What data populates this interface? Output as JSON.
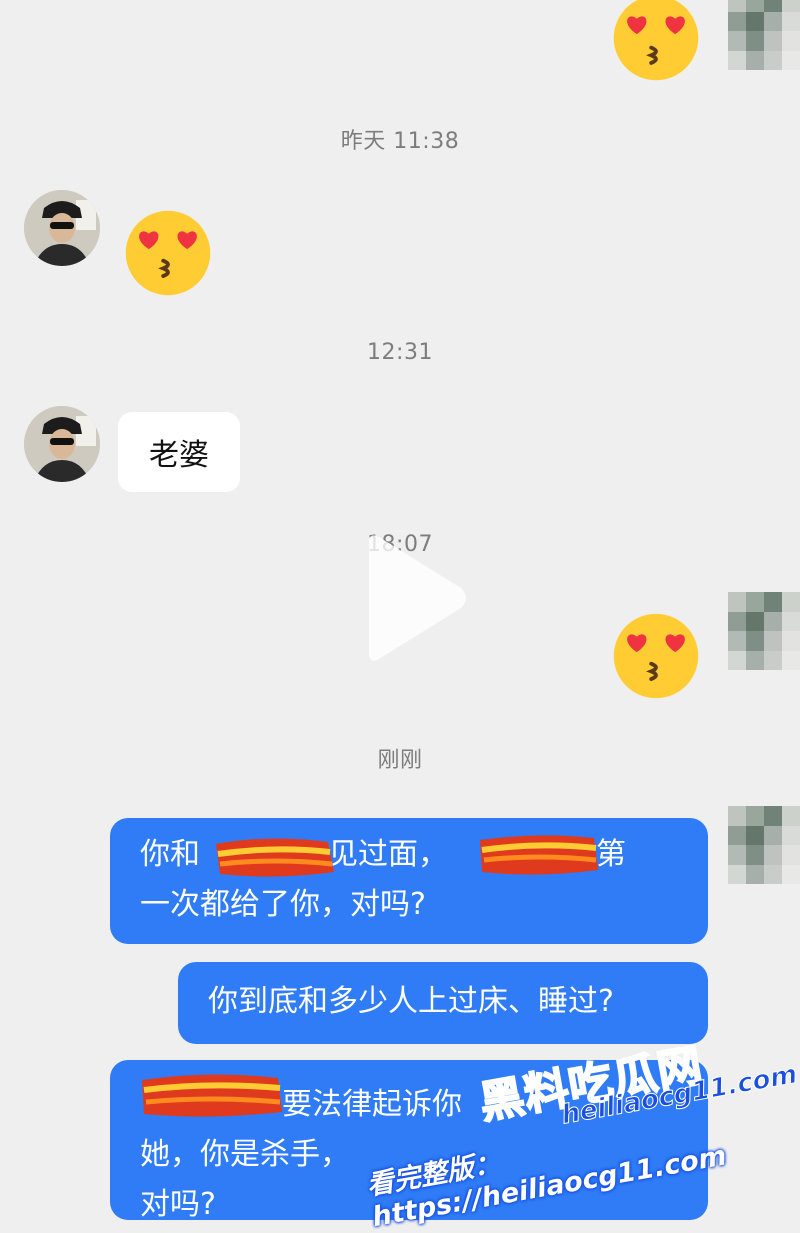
{
  "chat": {
    "timestamps": [
      "昨天 11:38",
      "12:31",
      "18:07",
      "刚刚"
    ],
    "messages": [
      {
        "side": "right",
        "type": "emoji",
        "icon": "heart-eyes-kiss-emoji"
      },
      {
        "side": "left",
        "type": "emoji",
        "icon": "heart-eyes-kiss-emoji"
      },
      {
        "side": "left",
        "type": "text",
        "text": "老婆"
      },
      {
        "side": "right",
        "type": "emoji",
        "icon": "heart-eyes-kiss-emoji"
      },
      {
        "side": "right",
        "type": "text",
        "text_a": "你和",
        "text_b": "见过面，",
        "text_c": "把第",
        "text_d": "一次都给了你，对吗?"
      },
      {
        "side": "right",
        "type": "text",
        "text": "你到底和多少人上过床、睡过?"
      },
      {
        "side": "right",
        "type": "text",
        "text_a": "要法律起诉你",
        "text_b": "她，你是杀手，",
        "text_c": "对吗?"
      }
    ]
  },
  "overlay": {
    "play_icon": "play-icon",
    "watermark": {
      "brand": "黑料吃瓜网",
      "prompt": "看完整版：",
      "url": "https://heiliaocg11.com",
      "url_logo": "heiliaocg11.com"
    }
  },
  "colors": {
    "background": "#efefef",
    "bubble_blue": "#2f7cf6",
    "bubble_white": "#ffffff",
    "timestamp": "#7d7d7d"
  }
}
